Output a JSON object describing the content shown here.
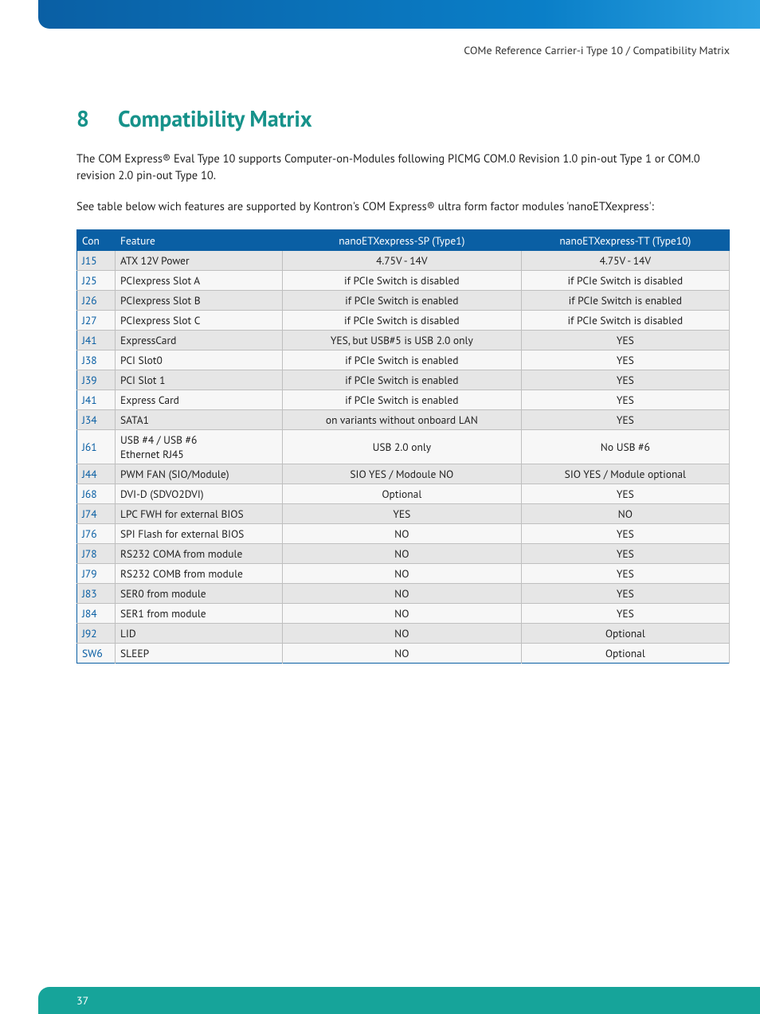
{
  "header": {
    "breadcrumb": "COMe Reference Carrier-i Type 10 / Compatibility Matrix"
  },
  "section": {
    "number": "8",
    "title": "Compatibility Matrix"
  },
  "para1": "The COM Express® Eval Type 10 supports Computer-on-Modules following PICMG COM.0 Revision 1.0 pin-out Type 1 or COM.0 revision 2.0 pin-out Type 10.",
  "para2": "See table below wich features are supported by Kontron's COM Express® ultra form factor modules 'nanoETXexpress':",
  "table": {
    "headers": [
      "Con",
      "Feature",
      "nanoETXexpress-SP (Type1)",
      "nanoETXexpress-TT (Type10)"
    ],
    "rows": [
      [
        "J15",
        "ATX 12V Power",
        "4.75V - 14V",
        "4.75V - 14V"
      ],
      [
        "J25",
        "PCIexpress Slot A",
        "if PCIe Switch is disabled",
        "if PCIe Switch is disabled"
      ],
      [
        "J26",
        "PCIexpress Slot B",
        "if PCIe Switch is enabled",
        "if PCIe Switch is enabled"
      ],
      [
        "J27",
        "PCIexpress Slot C",
        "if PCIe Switch is disabled",
        "if PCIe Switch is disabled"
      ],
      [
        "J41",
        "ExpressCard",
        "YES, but USB#5 is USB 2.0 only",
        "YES"
      ],
      [
        "J38",
        "PCI Slot0",
        "if PCIe Switch is enabled",
        "YES"
      ],
      [
        "J39",
        "PCI Slot 1",
        "if PCIe Switch is enabled",
        "YES"
      ],
      [
        "J41",
        "Express Card",
        "if PCIe Switch is enabled",
        "YES"
      ],
      [
        "J34",
        "SATA1",
        "on variants without onboard LAN",
        "YES"
      ],
      [
        "J61",
        "USB #4 / USB #6\nEthernet RJ45",
        "USB 2.0 only",
        "No USB #6"
      ],
      [
        "J44",
        "PWM FAN (SIO/Module)",
        "SIO YES / Modoule NO",
        "SIO YES / Module optional"
      ],
      [
        "J68",
        "DVI-D (SDVO2DVI)",
        "Optional",
        "YES"
      ],
      [
        "J74",
        "LPC FWH for external BIOS",
        "YES",
        "NO"
      ],
      [
        "J76",
        "SPI Flash for external BIOS",
        "NO",
        "YES"
      ],
      [
        "J78",
        "RS232 COMA from module",
        "NO",
        "YES"
      ],
      [
        "J79",
        "RS232 COMB from module",
        "NO",
        "YES"
      ],
      [
        "J83",
        "SER0 from module",
        "NO",
        "YES"
      ],
      [
        "J84",
        "SER1 from module",
        "NO",
        "YES"
      ],
      [
        "J92",
        "LID",
        "NO",
        "Optional"
      ],
      [
        "SW6",
        "SLEEP",
        "NO",
        "Optional"
      ]
    ]
  },
  "footer": {
    "page": "37"
  }
}
